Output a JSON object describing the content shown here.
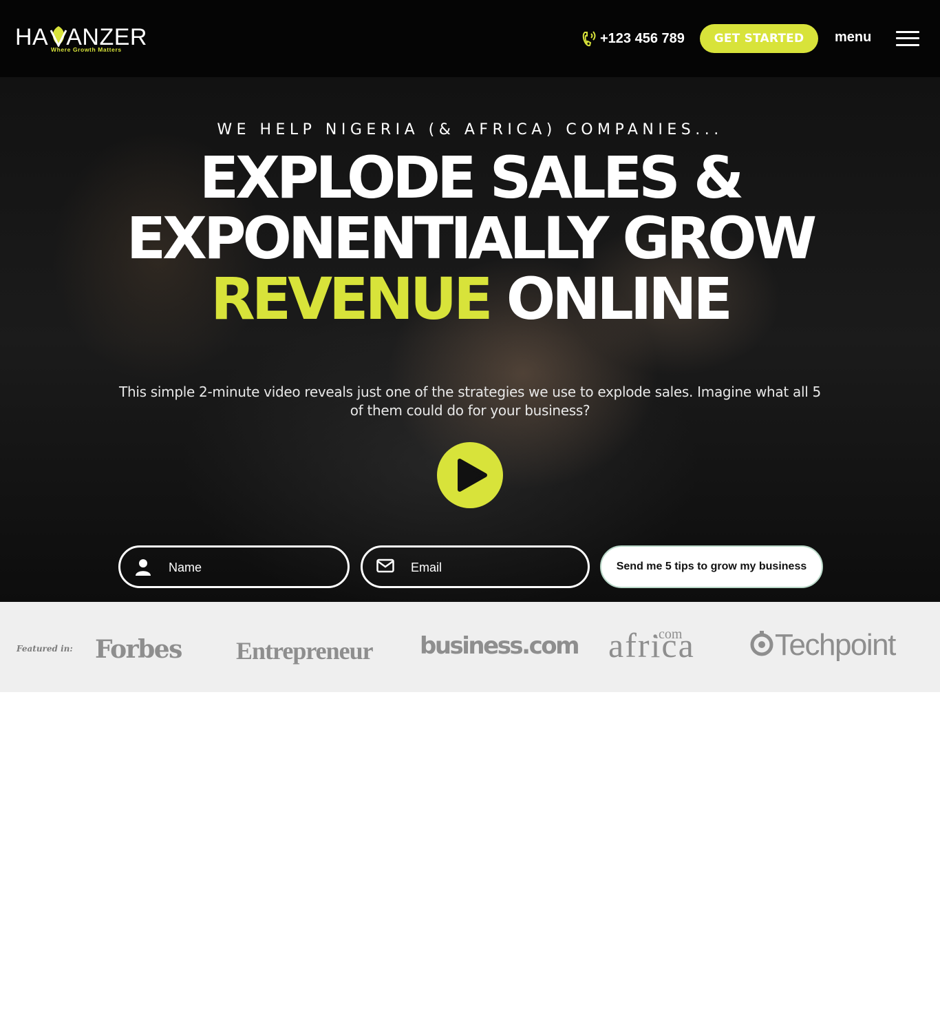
{
  "header": {
    "logo": {
      "text_left": "HA",
      "text_right": "ANZER",
      "tagline": "Where Growth Matters"
    },
    "phone": "+123 456 789",
    "cta_label": "GET STARTED",
    "menu_label": "menu"
  },
  "hero": {
    "kicker": "WE HELP NIGERIA (& AFRICA) COMPANIES...",
    "headline": {
      "line1": "EXPLODE SALES &",
      "line2": "EXPONENTIALLY GROW",
      "accent": "REVENUE",
      "line3_rest": "ONLINE"
    },
    "subtext": "This simple 2-minute video reveals just one of the strategies we use to explode sales. Imagine what all 5 of them could do for your business?",
    "form": {
      "name_placeholder": "Name",
      "email_placeholder": "Email",
      "submit_label": "Send me 5 tips to grow my business"
    }
  },
  "featured": {
    "label": "Featured in:",
    "brands": {
      "forbes": "Forbes",
      "entrepreneur": "Entrepreneur",
      "business": "business.com",
      "africa": "africa",
      "africa_com": ".com",
      "techpoint": "Techpoint"
    }
  },
  "colors": {
    "accent": "#d8e33a",
    "header_bg": "#050505",
    "featured_bg": "#efefef",
    "brand_gray": "#8e8e8e"
  }
}
